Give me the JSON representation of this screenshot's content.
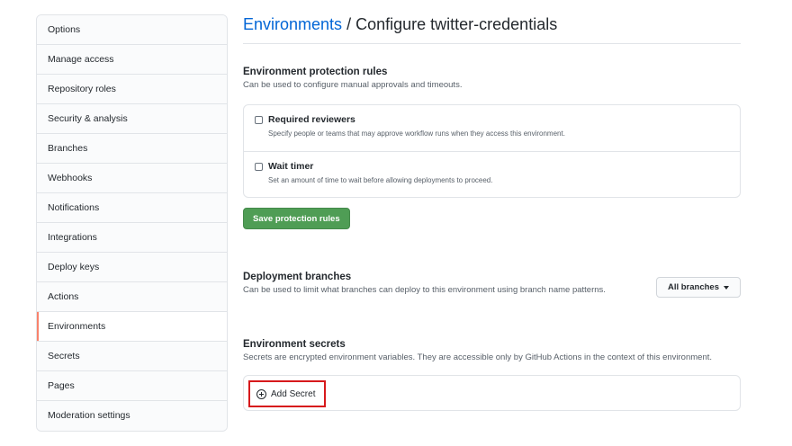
{
  "sidebar": {
    "items": [
      {
        "label": "Options"
      },
      {
        "label": "Manage access"
      },
      {
        "label": "Repository roles"
      },
      {
        "label": "Security & analysis"
      },
      {
        "label": "Branches"
      },
      {
        "label": "Webhooks"
      },
      {
        "label": "Notifications"
      },
      {
        "label": "Integrations"
      },
      {
        "label": "Deploy keys"
      },
      {
        "label": "Actions"
      },
      {
        "label": "Environments"
      },
      {
        "label": "Secrets"
      },
      {
        "label": "Pages"
      },
      {
        "label": "Moderation settings"
      }
    ],
    "active_item": "Environments",
    "active_accent": "#f9826c"
  },
  "header": {
    "breadcrumb_link": "Environments",
    "separator": "/",
    "title": "Configure twitter-credentials"
  },
  "protection": {
    "heading": "Environment protection rules",
    "description": "Can be used to configure manual approvals and timeouts.",
    "rules": [
      {
        "label": "Required reviewers",
        "description": "Specify people or teams that may approve workflow runs when they access this environment.",
        "checked": false
      },
      {
        "label": "Wait timer",
        "description": "Set an amount of time to wait before allowing deployments to proceed.",
        "checked": false
      }
    ],
    "save_label": "Save protection rules",
    "save_color": "#4f9d55"
  },
  "deployment": {
    "heading": "Deployment branches",
    "description": "Can be used to limit what branches can deploy to this environment using branch name patterns.",
    "dropdown_value": "All branches"
  },
  "secrets": {
    "heading": "Environment secrets",
    "description": "Secrets are encrypted environment variables. They are accessible only by GitHub Actions in the context of this environment.",
    "add_label": "Add Secret",
    "add_icon": "plus-circle-icon",
    "highlight_color": "#d7191c"
  }
}
